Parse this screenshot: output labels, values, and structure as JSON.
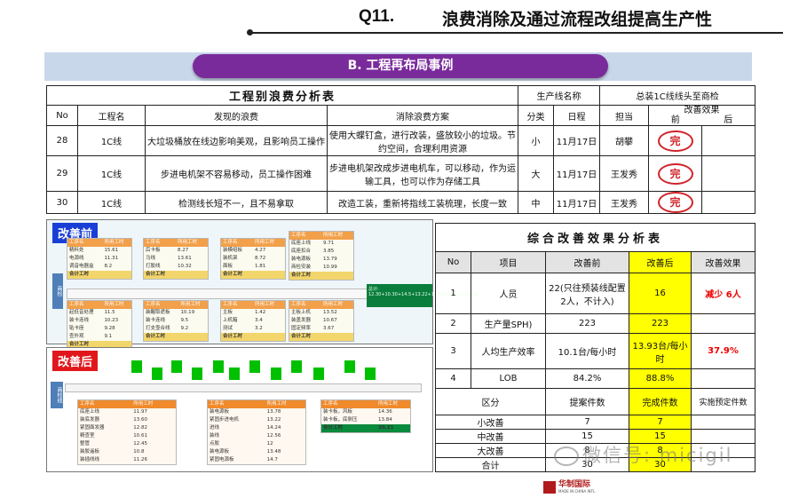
{
  "header": {
    "q": "Q11.",
    "title": "浪费消除及通过流程改组提高生产性"
  },
  "section": {
    "label": "B. 工程再布局事例"
  },
  "waste_table": {
    "title": "工程别浪费分析表",
    "line_name_label": "生产线名称",
    "line_name_value": "总装1C线线头至商检",
    "headers": [
      "No",
      "工程名",
      "发现的浪费",
      "消除浪费方案",
      "分类",
      "日程",
      "担当",
      "改善效果"
    ],
    "effect_sub": [
      "前",
      "后"
    ],
    "rows": [
      {
        "no": "28",
        "proc": "1C线",
        "waste": "大垃圾桶放在线边影响美观，且影响员工操作",
        "plan": "使用大蝶钉盒，进行改装，盛放较小的垃圾。节约空间，合理利用资源",
        "cls": "小",
        "date": "11月17日",
        "owner": "胡攀",
        "stamp": "完"
      },
      {
        "no": "29",
        "proc": "1C线",
        "waste": "步进电机架不容易移动，员工操作困难",
        "plan": "步进电机架改成步进电机车，可以移动，作为运输工具，也可以作为存储工具",
        "cls": "大",
        "date": "11月17日",
        "owner": "王发秀",
        "stamp": "完"
      },
      {
        "no": "30",
        "proc": "1C线",
        "waste": "检测线长短不一，且不易拿取",
        "plan": "改造工装，重新将指线工装梳理，长度一致",
        "cls": "中",
        "date": "11月17日",
        "owner": "王发秀",
        "stamp": "完"
      }
    ]
  },
  "before": {
    "tag": "改善前",
    "side_label": "商检",
    "blocks": [
      {
        "h1": "工序名",
        "h2": "所用工时",
        "rows": [
          [
            "精料处",
            "15.61"
          ],
          [
            "电源线",
            "11.31"
          ],
          [
            "调音电器盒",
            "8.2"
          ]
        ],
        "foot": "合计工时"
      },
      {
        "h1": "工序名",
        "h2": "所用工时",
        "rows": [
          [
            "后卡板",
            "8.27"
          ],
          [
            "马线",
            "13.61"
          ],
          [
            "打胶线",
            "10.32"
          ]
        ],
        "foot": "合计工时"
      },
      {
        "h1": "工序名",
        "h2": "所用工时",
        "rows": [
          [
            "装模组板",
            "4.27"
          ],
          [
            "装机架",
            "8.72"
          ],
          [
            "面板",
            "1.81"
          ]
        ],
        "foot": "合计工时"
      },
      {
        "h1": "工序名",
        "h2": "所用工时",
        "rows": [
          [
            "底座上线",
            "9.71"
          ],
          [
            "底座扣合",
            "3.85"
          ],
          [
            "装电源板",
            "13.79"
          ],
          [
            "商检安装",
            "10.99"
          ]
        ],
        "foot": "合计工时"
      },
      {
        "h1": "工序名",
        "h2": "所用工时",
        "rows": [
          [
            "起低音处理",
            "11.5"
          ],
          [
            "装卡连线",
            "10.23"
          ],
          [
            "贴卡座",
            "9.28"
          ],
          [
            "查外观",
            "9.1"
          ]
        ],
        "foot": "合计工时"
      },
      {
        "h1": "工序名",
        "h2": "所用工时",
        "rows": [
          [
            "装醒取遮板",
            "10.19"
          ],
          [
            "装卡连线",
            "9.5"
          ],
          [
            "打支壶合线",
            "9.2"
          ]
        ],
        "foot": "合计工时"
      },
      {
        "h1": "工序名",
        "h2": "所用工时",
        "rows": [
          [
            "主板",
            "1.42"
          ],
          [
            "上机箱",
            "3.4"
          ],
          [
            "测试",
            "3.2"
          ]
        ],
        "foot": "合计工时"
      },
      {
        "h1": "工序名",
        "h2": "所用工时",
        "rows": [
          [
            "主板上机",
            "13.52"
          ],
          [
            "装盖发器",
            "10.67"
          ],
          [
            "固定频率",
            "3.67"
          ]
        ],
        "foot": "合计工时"
      }
    ],
    "note": "总计: 12.30+10.30+14.5+13.22+13.50+12.12+10.30"
  },
  "after": {
    "tag": "改善后",
    "side_label": "商检线",
    "blocks": [
      {
        "h1": "工序名",
        "h2": "所用工时",
        "rows": [
          [
            "底座上线",
            "11.97"
          ],
          [
            "装底发器",
            "13.60"
          ],
          [
            "紧固面发器",
            "12.82"
          ],
          [
            "精查室",
            "10.61"
          ],
          [
            "整管",
            "12.45"
          ],
          [
            "装胶遥板",
            "10.8"
          ],
          [
            "装插线线",
            "11.26"
          ]
        ]
      },
      {
        "h1": "工序名",
        "h2": "所用工时",
        "rows": [
          [
            "装电源板",
            "13.78"
          ],
          [
            "紧固步进电机",
            "13.22"
          ],
          [
            "进线",
            "14.24"
          ],
          [
            "装线",
            "12.56"
          ],
          [
            "点胶",
            "12"
          ],
          [
            "装电源板",
            "13.48"
          ],
          [
            "紧固电源板",
            "14.7"
          ]
        ]
      },
      {
        "h1": "工序名",
        "h2": "所用工时",
        "rows": [
          [
            "装卡板，风板",
            "14.36"
          ],
          [
            "装卡板，底侧压",
            "13.84"
          ]
        ],
        "foot": "合计工时",
        "foot_val": "20.21"
      }
    ]
  },
  "summary": {
    "title": "综合改善效果分析表",
    "headers": [
      "No",
      "项目",
      "改善前",
      "改善后",
      "改善效果"
    ],
    "rows": [
      {
        "no": "1",
        "item": "人员",
        "before": "22(只往预装线配置2人，不计入)",
        "after": "16",
        "effect": "减少 6人"
      },
      {
        "no": "2",
        "item": "生产量SPH)",
        "before": "223",
        "after": "223",
        "effect": ""
      },
      {
        "no": "3",
        "item": "人均生产效率",
        "before": "10.1台/每小时",
        "after": "13.93台/每小时",
        "effect": "37.9%"
      },
      {
        "no": "4",
        "item": "LOB",
        "before": "84.2%",
        "after": "88.8%",
        "effect": ""
      }
    ],
    "sub_headers": [
      "区分",
      "提案件数",
      "完成件数",
      "实施预定件数"
    ],
    "sub_rows": [
      {
        "k": "小改善",
        "a": "7",
        "b": "7",
        "c": ""
      },
      {
        "k": "中改善",
        "a": "15",
        "b": "15",
        "c": ""
      },
      {
        "k": "大改善",
        "a": "8",
        "b": "8",
        "c": ""
      },
      {
        "k": "合计",
        "a": "30",
        "b": "30",
        "c": ""
      }
    ]
  },
  "watermark": {
    "text": "微信号: micigil"
  },
  "logo": {
    "brand": "华制国际",
    "sub": "MADE IN CHINA INTL"
  },
  "colors": {
    "purple": "#7a2b9b",
    "blue_tag": "#1a3fd6",
    "red_tag": "#e0161b",
    "yellow": "#ffff00",
    "green_block": "#00c000",
    "before_bg": "#cfe0ea"
  }
}
